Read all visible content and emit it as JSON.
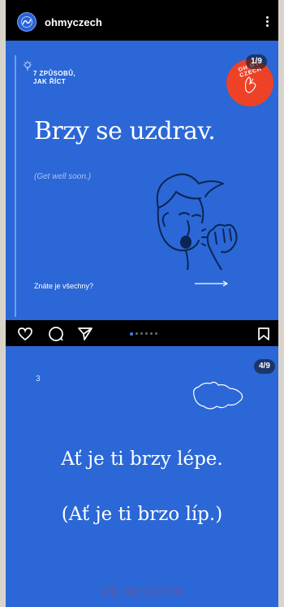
{
  "header": {
    "username": "ohmyczech",
    "more_icon": "more-vertical-icon"
  },
  "slide1": {
    "counter": "1/9",
    "kicker_line1": "7 ZPŮSOBŮ,",
    "kicker_line2": "JAK ŘÍCT",
    "headline": "Brzy se uzdrav.",
    "translation": "(Get well soon.)",
    "cta": "Znáte je všechny?",
    "badge_text": "OH MY CZECH",
    "colors": {
      "background": "#2b67d6",
      "badge": "#ee4226"
    }
  },
  "actions": {
    "icons": [
      "heart-icon",
      "comment-icon",
      "share-icon",
      "bookmark-icon"
    ],
    "carousel_total": 6,
    "carousel_active": 1
  },
  "slide2": {
    "counter": "4/9",
    "number": "3",
    "headline_line1": "Ať je ti brzy lépe.",
    "headline_line2": "(Ať je ti brzo líp.)",
    "watermark": "Oh my Czech"
  }
}
